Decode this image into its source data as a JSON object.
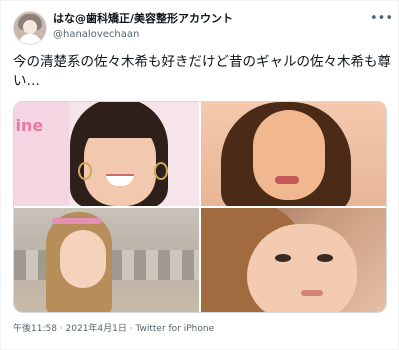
{
  "tweet": {
    "display_name": "はな@歯科矯正/美容整形アカウント",
    "handle": "@hanalovechaan",
    "more_icon": "•••",
    "text": "今の清楚系の佐々木希も好きだけど昔のギャルの佐々木希も尊い…",
    "photos": [
      {
        "label": "photo-1"
      },
      {
        "label": "photo-2"
      },
      {
        "label": "photo-3"
      },
      {
        "label": "photo-4"
      }
    ],
    "photo1_overlay_text": "line",
    "time": "午後11:58",
    "date": "2021年4月1日",
    "source": "Twitter for iPhone",
    "separator": " · "
  }
}
